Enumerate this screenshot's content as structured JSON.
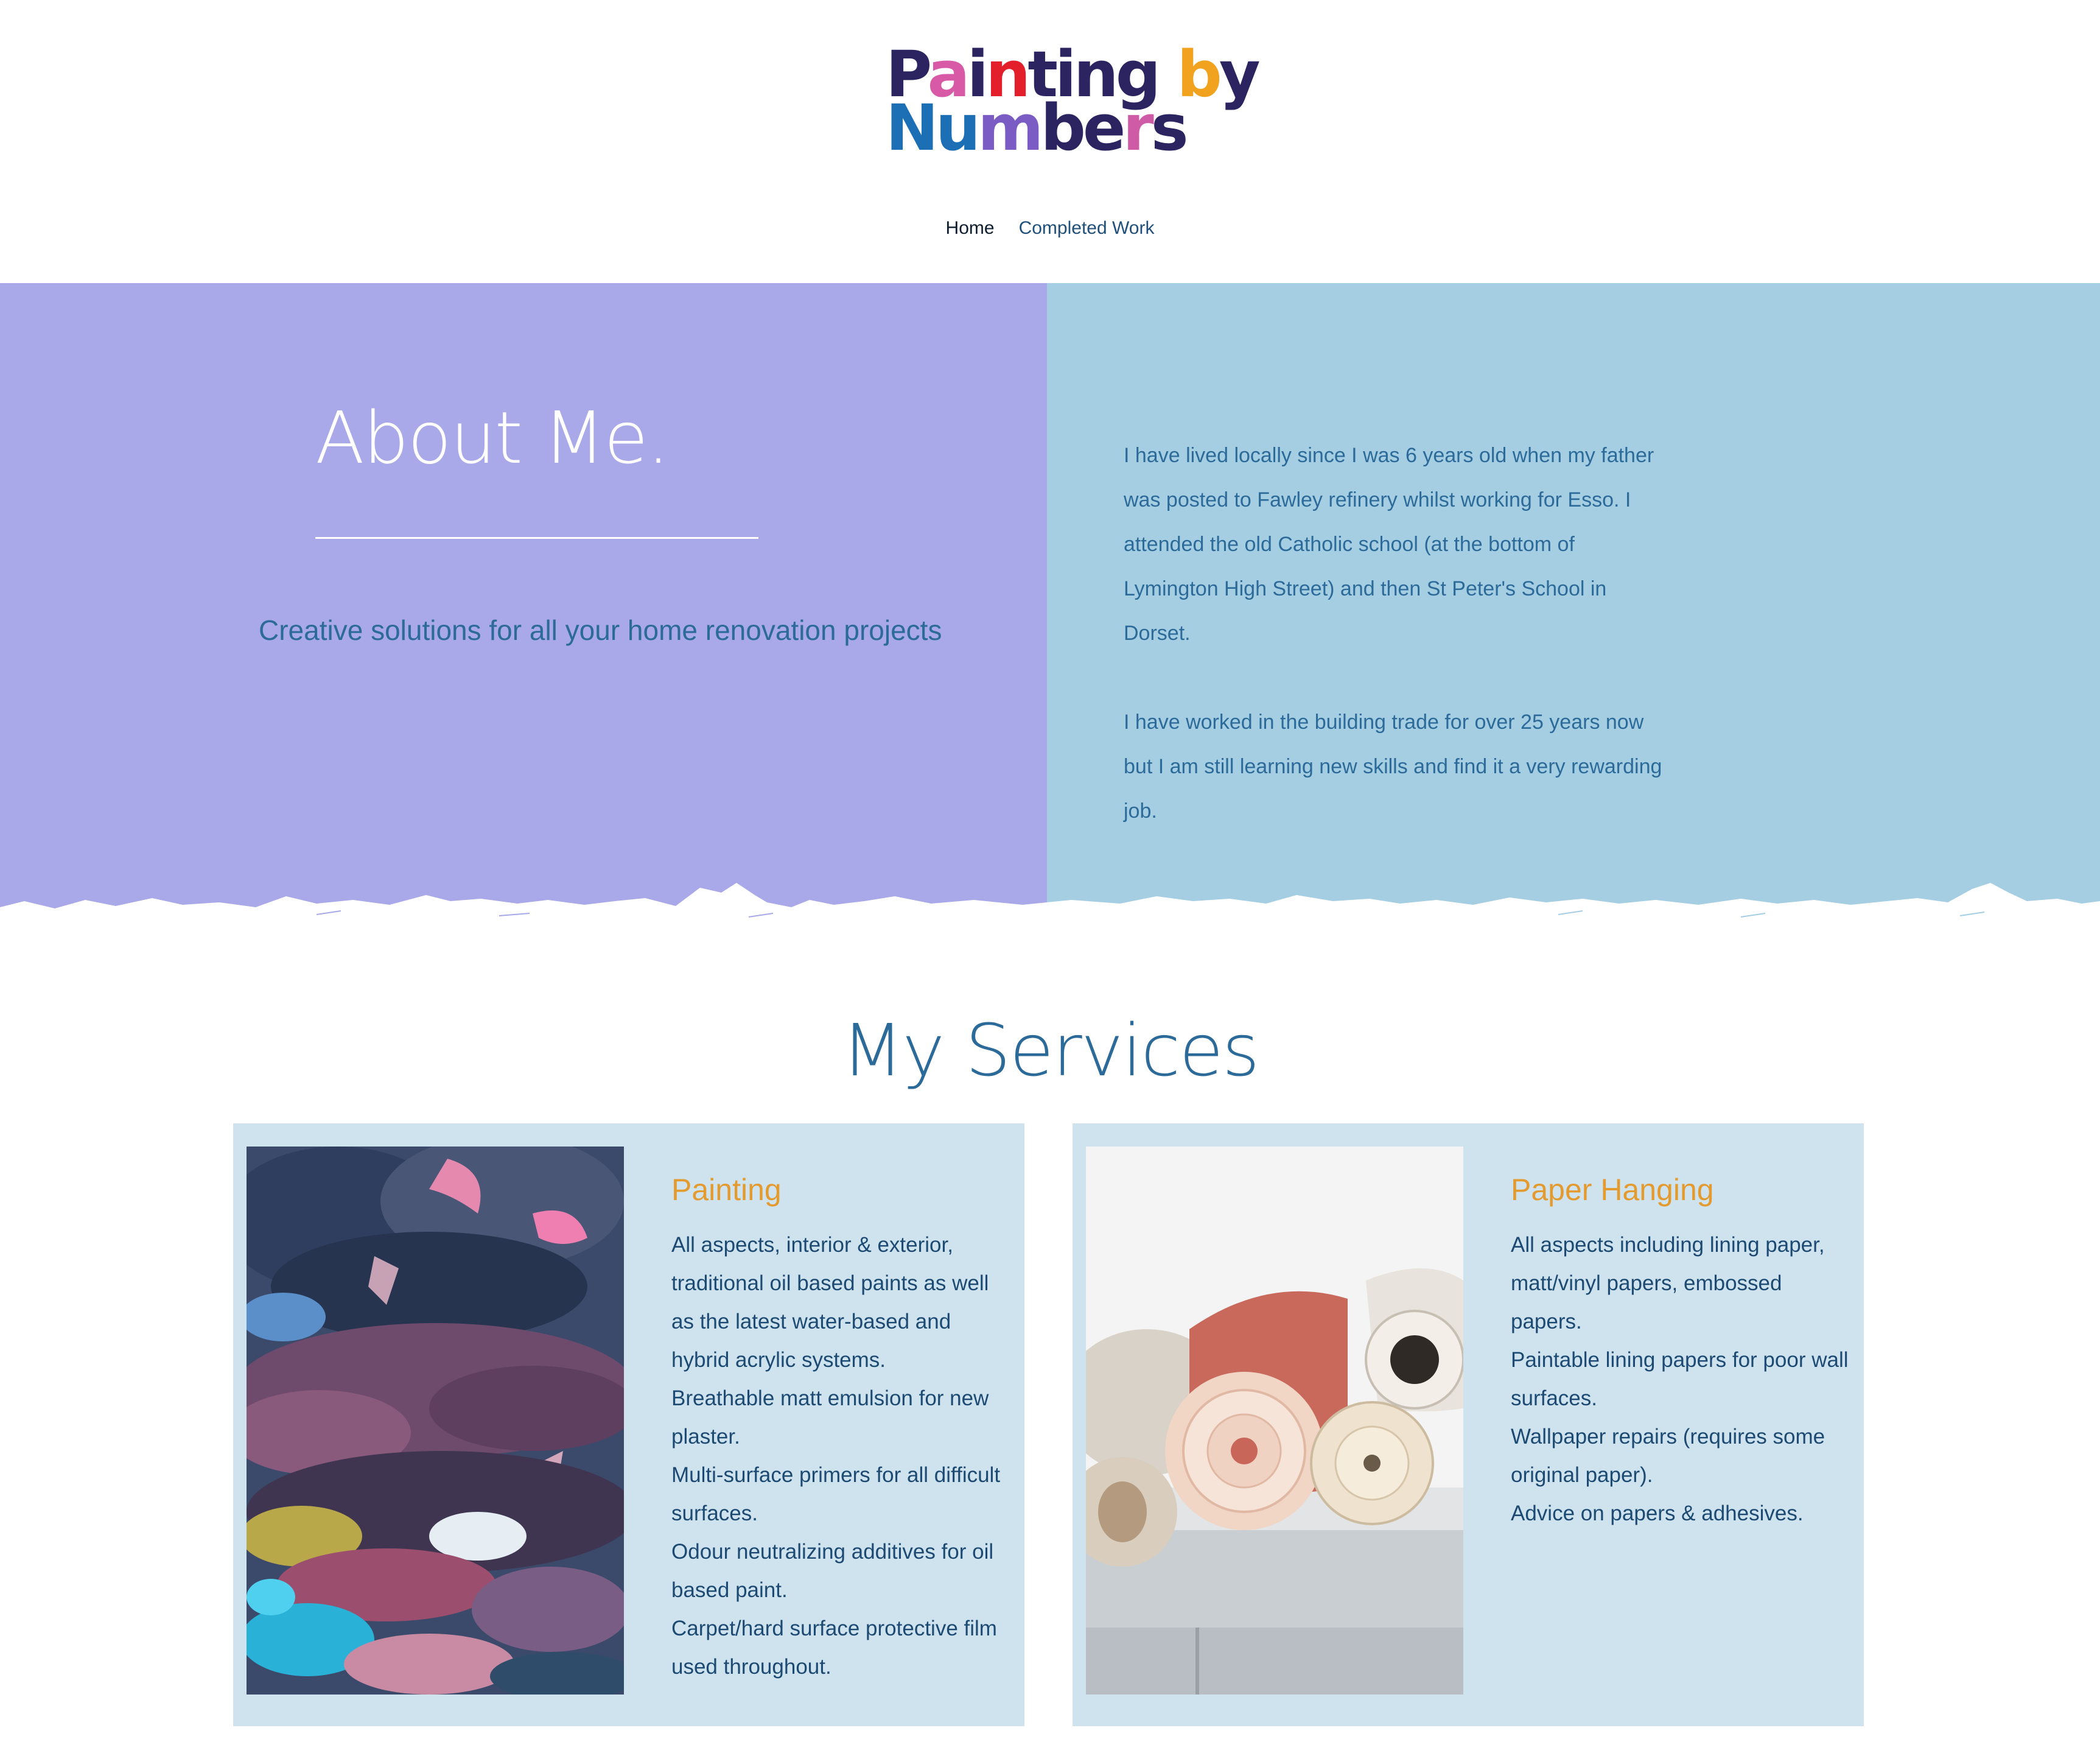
{
  "logo": {
    "line1": "Painting by",
    "line2": "Numbers",
    "letter_colors_line1": [
      "#2b2461",
      "#d85aa6",
      "#2b2461",
      "#e21f2a",
      "#2b2461",
      "#2b2461",
      "#2b2461",
      "#2b2461",
      "#f1a320",
      "#2b2461",
      "#2b2461"
    ],
    "letter_colors_line2": [
      "#1c6fb5",
      "#1c6fb5",
      "#7b5cc4",
      "#2b2461",
      "#2b2461",
      "#cf5aa6",
      "#2b2461"
    ]
  },
  "nav": {
    "items": [
      {
        "label": "Home",
        "active": true
      },
      {
        "label": "Completed Work",
        "active": false
      }
    ]
  },
  "about": {
    "title": "About Me.",
    "tagline": "Creative solutions for all your home renovation projects",
    "paragraphs": [
      "I have lived locally since I was 6 years old when my father was posted to Fawley refinery whilst working for Esso. I attended the old Catholic school (at the bottom of Lymington High Street) and then St Peter's School in Dorset.",
      "I have worked in the building trade for over 25 years now but I am still learning new skills and find it a very rewarding job."
    ]
  },
  "services": {
    "title": "My Services",
    "cards": [
      {
        "title": "Painting",
        "image_icon": "paint-palette-image",
        "lines": [
          "All aspects, interior & exterior, traditional oil based paints as well as the latest water-based and hybrid acrylic systems.",
          "Breathable matt emulsion for new plaster.",
          "Multi-surface primers for all difficult surfaces.",
          "Odour neutralizing additives for oil based paint.",
          "Carpet/hard surface protective film used throughout."
        ]
      },
      {
        "title": "Paper Hanging",
        "image_icon": "wallpaper-rolls-image",
        "lines": [
          "All aspects including lining paper, matt/vinyl papers, embossed papers.",
          "Paintable lining papers for poor wall surfaces.",
          "Wallpaper repairs (requires some original paper).",
          "Advice on papers & adhesives."
        ]
      }
    ]
  },
  "colors": {
    "about_left_bg": "#a9a9e9",
    "about_right_bg": "#a5cee3",
    "accent_text": "#2c6b99",
    "card_bg": "#cfe3ef",
    "card_title": "#e39a2e"
  }
}
